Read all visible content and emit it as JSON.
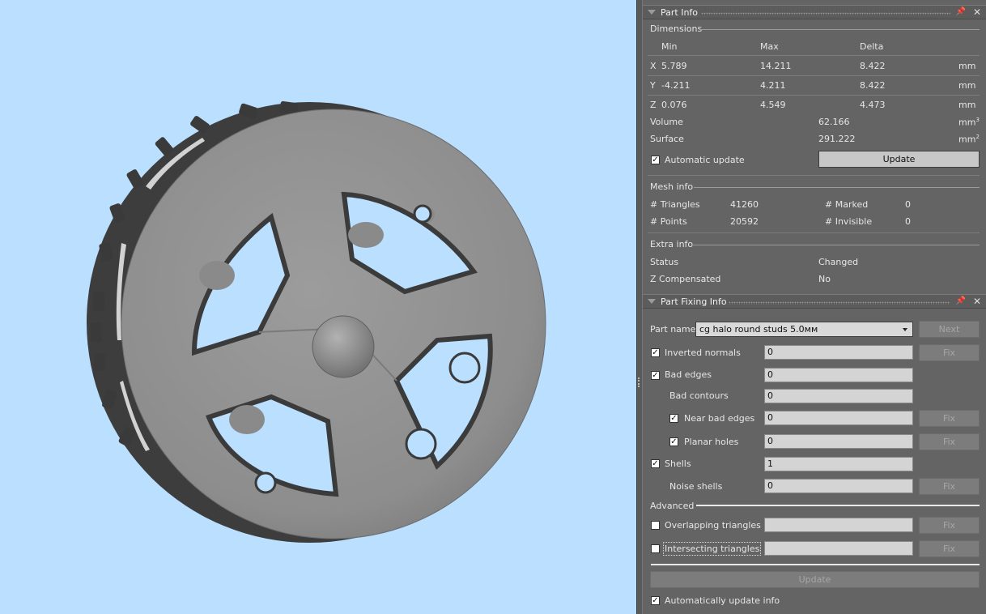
{
  "part_info": {
    "title": "Part Info",
    "dimensions": {
      "label": "Dimensions",
      "headers": {
        "min": "Min",
        "max": "Max",
        "delta": "Delta"
      },
      "rows": [
        {
          "axis": "X",
          "min": "5.789",
          "max": "14.211",
          "delta": "8.422",
          "unit": "mm"
        },
        {
          "axis": "Y",
          "min": "-4.211",
          "max": "4.211",
          "delta": "8.422",
          "unit": "mm"
        },
        {
          "axis": "Z",
          "min": "0.076",
          "max": "4.549",
          "delta": "4.473",
          "unit": "mm"
        }
      ],
      "volume_label": "Volume",
      "volume": "62.166",
      "volume_unit": "mm",
      "volume_exp": "3",
      "surface_label": "Surface",
      "surface": "291.222",
      "surface_unit": "mm",
      "surface_exp": "2",
      "auto_update_label": "Automatic update",
      "auto_update_checked": true,
      "update_button": "Update"
    },
    "mesh_info": {
      "label": "Mesh info",
      "triangles_label": "# Triangles",
      "triangles": "41260",
      "points_label": "# Points",
      "points": "20592",
      "marked_label": "# Marked",
      "marked": "0",
      "invisible_label": "# Invisible",
      "invisible": "0"
    },
    "extra_info": {
      "label": "Extra info",
      "status_label": "Status",
      "status": "Changed",
      "zcomp_label": "Z Compensated",
      "zcomp": "No"
    }
  },
  "part_fixing": {
    "title": "Part Fixing Info",
    "part_name_label": "Part name",
    "part_name": "cg halo round studs 5.0мм",
    "next_button": "Next",
    "fix_button": "Fix",
    "inverted_normals": {
      "label": "Inverted normals",
      "value": "0",
      "checked": true
    },
    "bad_edges": {
      "label": "Bad edges",
      "value": "0",
      "checked": true
    },
    "bad_contours": {
      "label": "Bad contours",
      "value": "0"
    },
    "near_bad_edges": {
      "label": "Near bad edges",
      "value": "0",
      "checked": true
    },
    "planar_holes": {
      "label": "Planar holes",
      "value": "0",
      "checked": true
    },
    "shells": {
      "label": "Shells",
      "value": "1",
      "checked": true
    },
    "noise_shells": {
      "label": "Noise shells",
      "value": "0"
    },
    "advanced_label": "Advanced",
    "overlapping": {
      "label": "Overlapping triangles",
      "value": "",
      "checked": false
    },
    "intersecting": {
      "label": "Intersecting triangles",
      "value": "",
      "checked": false
    },
    "update_button": "Update",
    "auto_update_info_label": "Automatically update info",
    "auto_update_info_checked": true
  },
  "colors": {
    "viewport_bg": "#badfff",
    "part_gray": "#8e8e8e",
    "panel_bg": "#646464"
  }
}
